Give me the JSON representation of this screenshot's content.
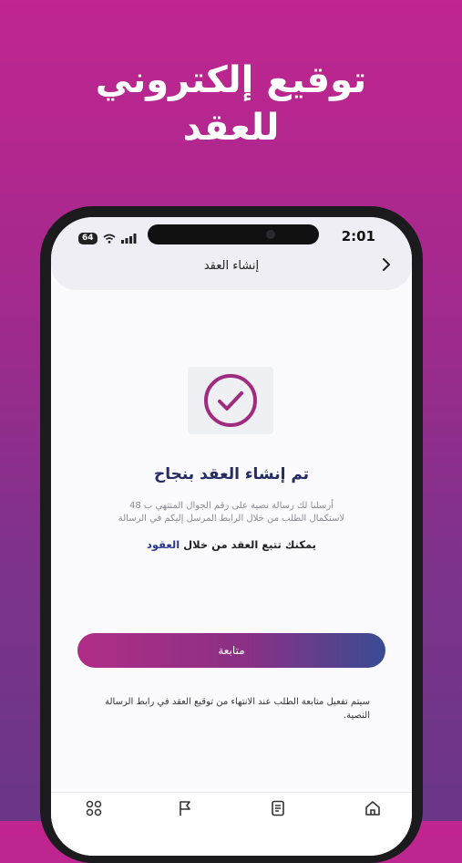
{
  "promo": {
    "title_line1": "توقيع إلكتروني",
    "title_line2": "للعقد"
  },
  "status_bar": {
    "time": "2:01",
    "battery": "64"
  },
  "header": {
    "title": "إنشاء العقد"
  },
  "success": {
    "title": "تم إنشاء العقد بنجاح",
    "sms_line1": "أرسلنا لك رسالة نصية على رقم الجوال المنتهي ب 48",
    "sms_line2": "لاستكمال الطلب من خلال الرابط المرسل إليكم في الرسالة",
    "track_prefix": "يمكنك تتبع العقد من خلال",
    "track_link": "العقود"
  },
  "actions": {
    "continue_label": "متابعة"
  },
  "footer_note": "سيتم تفعيل متابعة الطلب عند الانتهاء من توقيع العقد في رابط الرسالة النصية.",
  "tabs": [
    {
      "icon": "home-icon"
    },
    {
      "icon": "document-icon"
    },
    {
      "icon": "flag-icon"
    },
    {
      "icon": "grid-icon"
    }
  ],
  "colors": {
    "brand_magenta": "#c1258f",
    "brand_navy": "#232c63",
    "check_purple": "#a02b7f"
  }
}
